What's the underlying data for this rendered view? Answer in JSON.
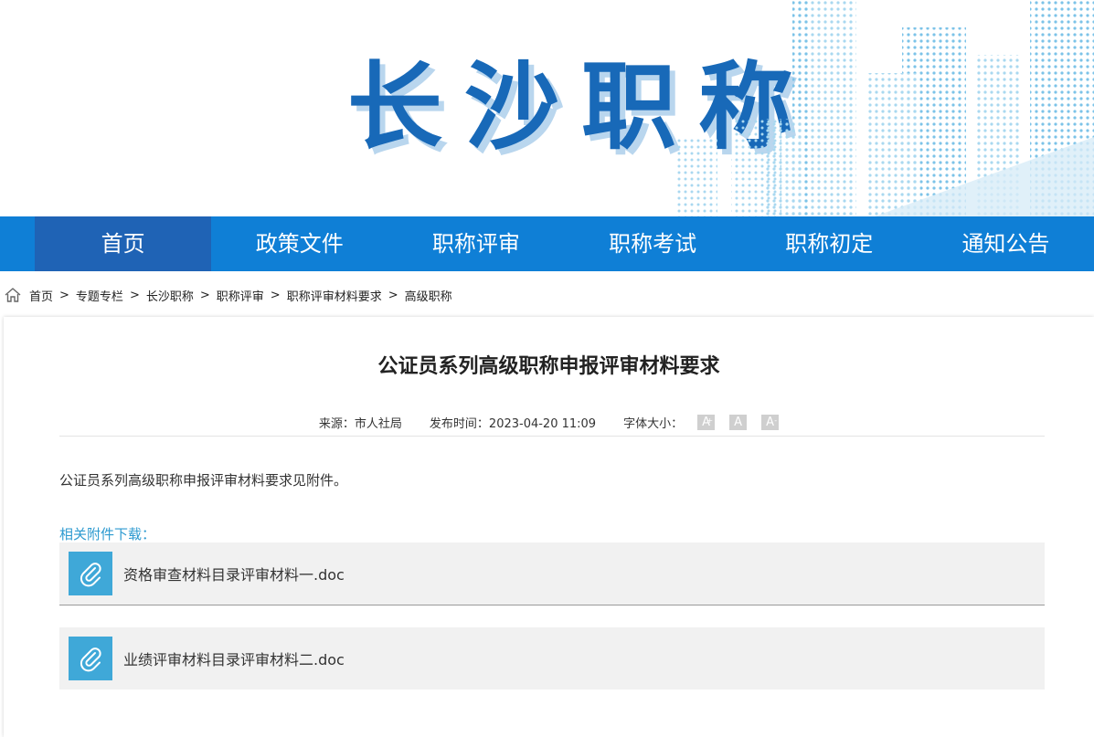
{
  "banner": {
    "logo_text": "长沙职称"
  },
  "nav": {
    "items": [
      {
        "label": "首页"
      },
      {
        "label": "政策文件"
      },
      {
        "label": "职称评审"
      },
      {
        "label": "职称考试"
      },
      {
        "label": "职称初定"
      },
      {
        "label": "通知公告"
      }
    ]
  },
  "breadcrumb": {
    "items": [
      "首页",
      "专题专栏",
      "长沙职称",
      "职称评审",
      "职称评审材料要求",
      "高级职称"
    ],
    "separator": ">"
  },
  "article": {
    "title": "公证员系列高级职称申报评审材料要求",
    "source_label": "来源：市人社局",
    "date_label": "发布时间：2023-04-20 11:09",
    "font_size_label": "字体大小：",
    "font_buttons": [
      "A",
      "A",
      "A"
    ],
    "body": "公证员系列高级职称申报评审材料要求见附件。",
    "attachments_label": "相关附件下载：",
    "attachments": [
      {
        "name": "资格审查材料目录评审材料一.doc"
      },
      {
        "name": "业绩评审材料目录评审材料二.doc"
      }
    ]
  },
  "colors": {
    "nav_bg": "#0f7fd6",
    "nav_active": "#1f63b5",
    "logo": "#1869b8",
    "attachment_icon": "#3fa8d8",
    "link_label": "#2d9ad0"
  }
}
